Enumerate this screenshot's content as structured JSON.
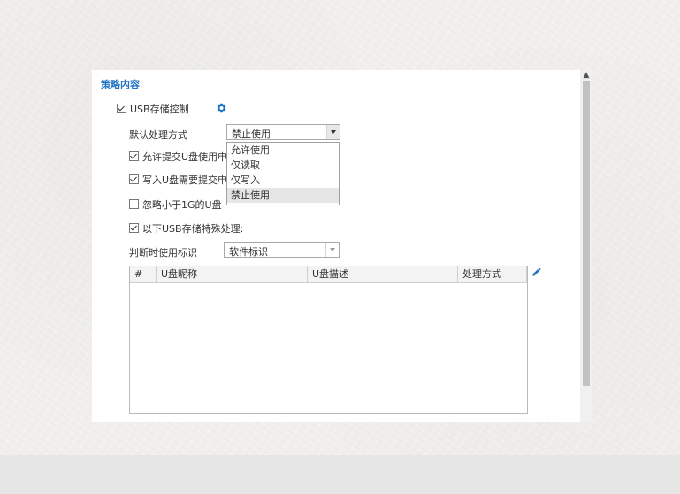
{
  "section": {
    "title": "策略内容"
  },
  "usb_control": {
    "label": "USB存储控制",
    "checked": true
  },
  "default_handling": {
    "label": "默认处理方式",
    "selected": "禁止使用"
  },
  "handling_options": [
    {
      "label": "允许使用"
    },
    {
      "label": "仅读取"
    },
    {
      "label": "仅写入"
    },
    {
      "label": "禁止使用",
      "selected": true
    }
  ],
  "options": {
    "allow_submit": {
      "label": "允许提交U盘使用申",
      "checked": true
    },
    "write_requires": {
      "label": "写入U盘需要提交申",
      "checked": true
    },
    "ignore_small": {
      "label": "忽略小于1G的U盘",
      "checked": false
    },
    "special_handling": {
      "label": "以下USB存储特殊处理:",
      "checked": true
    }
  },
  "identifier": {
    "label": "判断时使用标识",
    "selected": "软件标识"
  },
  "table": {
    "columns": [
      "#",
      "U盘昵称",
      "U盘描述",
      "处理方式"
    ],
    "rows": []
  },
  "icons": {
    "settings": "gear-icon",
    "edit": "pencil-icon"
  },
  "colors": {
    "accent": "#1f73c2"
  }
}
